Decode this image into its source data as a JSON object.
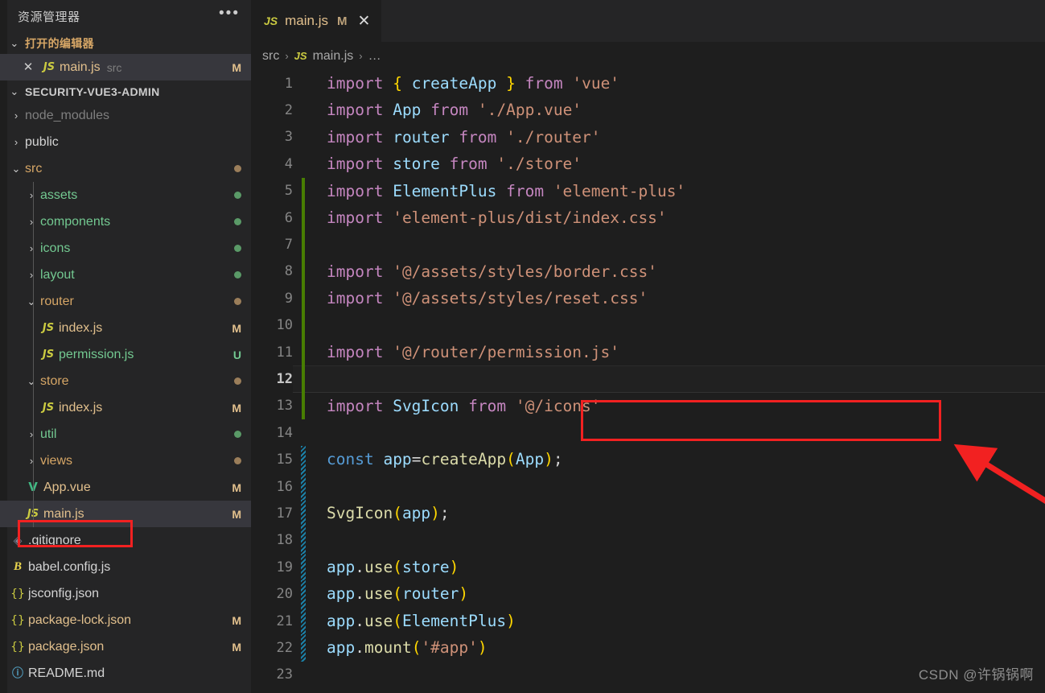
{
  "sidebar": {
    "title": "资源管理器",
    "more_icon": "•••",
    "open_editors": {
      "label": "打开的编辑器",
      "expanded_icon": "⌄",
      "items": [
        {
          "close_icon": "✕",
          "file_icon": "JS",
          "name": "main.js",
          "path": "src",
          "badge": "M"
        }
      ]
    },
    "project": {
      "label": "SECURITY-VUE3-ADMIN",
      "expanded_icon": "⌄"
    },
    "tree": [
      {
        "name": "node_modules",
        "depth": 1,
        "type": "folder",
        "twisty": "›",
        "color": "c-gray",
        "badge": "",
        "dot": ""
      },
      {
        "name": "public",
        "depth": 1,
        "type": "folder",
        "twisty": "›",
        "color": "c-plain",
        "badge": "",
        "dot": ""
      },
      {
        "name": "src",
        "depth": 1,
        "type": "folder",
        "twisty": "⌄",
        "color": "c-amber",
        "badge": "",
        "dot": "d-amber"
      },
      {
        "name": "assets",
        "depth": 2,
        "type": "folder",
        "twisty": "›",
        "color": "c-green",
        "badge": "",
        "dot": "d-green"
      },
      {
        "name": "components",
        "depth": 2,
        "type": "folder",
        "twisty": "›",
        "color": "c-green",
        "badge": "",
        "dot": "d-green"
      },
      {
        "name": "icons",
        "depth": 2,
        "type": "folder",
        "twisty": "›",
        "color": "c-green",
        "badge": "",
        "dot": "d-green"
      },
      {
        "name": "layout",
        "depth": 2,
        "type": "folder",
        "twisty": "›",
        "color": "c-green",
        "badge": "",
        "dot": "d-green"
      },
      {
        "name": "router",
        "depth": 2,
        "type": "folder",
        "twisty": "⌄",
        "color": "c-amber",
        "badge": "",
        "dot": "d-amber"
      },
      {
        "name": "index.js",
        "depth": 3,
        "type": "file",
        "icon": "js",
        "color": "c-tan",
        "badge": "M",
        "badge_color": "c-tan",
        "dot": ""
      },
      {
        "name": "permission.js",
        "depth": 3,
        "type": "file",
        "icon": "js",
        "color": "c-green",
        "badge": "U",
        "badge_color": "c-green",
        "dot": ""
      },
      {
        "name": "store",
        "depth": 2,
        "type": "folder",
        "twisty": "⌄",
        "color": "c-amber",
        "badge": "",
        "dot": "d-amber"
      },
      {
        "name": "index.js",
        "depth": 3,
        "type": "file",
        "icon": "js",
        "color": "c-tan",
        "badge": "M",
        "badge_color": "c-tan",
        "dot": ""
      },
      {
        "name": "util",
        "depth": 2,
        "type": "folder",
        "twisty": "›",
        "color": "c-green",
        "badge": "",
        "dot": "d-green"
      },
      {
        "name": "views",
        "depth": 2,
        "type": "folder",
        "twisty": "›",
        "color": "c-amber",
        "badge": "",
        "dot": "d-amber"
      },
      {
        "name": "App.vue",
        "depth": 2,
        "type": "file",
        "icon": "vue",
        "color": "c-tan",
        "badge": "M",
        "badge_color": "c-tan",
        "dot": ""
      },
      {
        "name": "main.js",
        "depth": 2,
        "type": "file",
        "icon": "js",
        "color": "c-tan",
        "badge": "M",
        "badge_color": "c-tan",
        "dot": "",
        "selected": true
      },
      {
        "name": ".gitignore",
        "depth": 1,
        "type": "file",
        "icon": "git",
        "color": "c-plain",
        "badge": "",
        "dot": ""
      },
      {
        "name": "babel.config.js",
        "depth": 1,
        "type": "file",
        "icon": "babel",
        "color": "c-plain",
        "badge": "",
        "dot": ""
      },
      {
        "name": "jsconfig.json",
        "depth": 1,
        "type": "file",
        "icon": "json",
        "color": "c-plain",
        "badge": "",
        "dot": ""
      },
      {
        "name": "package-lock.json",
        "depth": 1,
        "type": "file",
        "icon": "json",
        "color": "c-tan",
        "badge": "M",
        "badge_color": "c-tan",
        "dot": ""
      },
      {
        "name": "package.json",
        "depth": 1,
        "type": "file",
        "icon": "json",
        "color": "c-tan",
        "badge": "M",
        "badge_color": "c-tan",
        "dot": ""
      },
      {
        "name": "README.md",
        "depth": 1,
        "type": "file",
        "icon": "md",
        "color": "c-plain",
        "badge": "",
        "dot": ""
      }
    ]
  },
  "editor": {
    "tab": {
      "file_icon": "JS",
      "label": "main.js",
      "modified": "M",
      "close_icon": "✕"
    },
    "breadcrumb": {
      "root": "src",
      "sep": "›",
      "file_icon": "JS",
      "file": "main.js",
      "ellipsis": "…"
    },
    "active_line": 12,
    "lines": [
      {
        "n": 1,
        "gutter": "none",
        "tokens": [
          {
            "t": "import",
            "c": "t-kw"
          },
          {
            "t": " ",
            "c": "t-op"
          },
          {
            "t": "{",
            "c": "t-brc"
          },
          {
            "t": " ",
            "c": "t-op"
          },
          {
            "t": "createApp",
            "c": "t-id"
          },
          {
            "t": " ",
            "c": "t-op"
          },
          {
            "t": "}",
            "c": "t-brc"
          },
          {
            "t": " ",
            "c": "t-op"
          },
          {
            "t": "from",
            "c": "t-kw"
          },
          {
            "t": " ",
            "c": "t-op"
          },
          {
            "t": "'vue'",
            "c": "t-str"
          }
        ]
      },
      {
        "n": 2,
        "gutter": "none",
        "tokens": [
          {
            "t": "import",
            "c": "t-kw"
          },
          {
            "t": " ",
            "c": "t-op"
          },
          {
            "t": "App",
            "c": "t-id"
          },
          {
            "t": " ",
            "c": "t-op"
          },
          {
            "t": "from",
            "c": "t-kw"
          },
          {
            "t": " ",
            "c": "t-op"
          },
          {
            "t": "'./App.vue'",
            "c": "t-str"
          }
        ]
      },
      {
        "n": 3,
        "gutter": "none",
        "tokens": [
          {
            "t": "import",
            "c": "t-kw"
          },
          {
            "t": " ",
            "c": "t-op"
          },
          {
            "t": "router",
            "c": "t-id"
          },
          {
            "t": " ",
            "c": "t-op"
          },
          {
            "t": "from",
            "c": "t-kw"
          },
          {
            "t": " ",
            "c": "t-op"
          },
          {
            "t": "'./router'",
            "c": "t-str"
          }
        ]
      },
      {
        "n": 4,
        "gutter": "none",
        "tokens": [
          {
            "t": "import",
            "c": "t-kw"
          },
          {
            "t": " ",
            "c": "t-op"
          },
          {
            "t": "store",
            "c": "t-id"
          },
          {
            "t": " ",
            "c": "t-op"
          },
          {
            "t": "from",
            "c": "t-kw"
          },
          {
            "t": " ",
            "c": "t-op"
          },
          {
            "t": "'./store'",
            "c": "t-str"
          }
        ]
      },
      {
        "n": 5,
        "gutter": "green",
        "tokens": [
          {
            "t": "import",
            "c": "t-kw"
          },
          {
            "t": " ",
            "c": "t-op"
          },
          {
            "t": "ElementPlus",
            "c": "t-id"
          },
          {
            "t": " ",
            "c": "t-op"
          },
          {
            "t": "from",
            "c": "t-kw"
          },
          {
            "t": " ",
            "c": "t-op"
          },
          {
            "t": "'element-plus'",
            "c": "t-str"
          }
        ]
      },
      {
        "n": 6,
        "gutter": "green",
        "tokens": [
          {
            "t": "import",
            "c": "t-kw"
          },
          {
            "t": " ",
            "c": "t-op"
          },
          {
            "t": "'element-plus/dist/index.css'",
            "c": "t-str"
          }
        ]
      },
      {
        "n": 7,
        "gutter": "green",
        "tokens": []
      },
      {
        "n": 8,
        "gutter": "green",
        "tokens": [
          {
            "t": "import",
            "c": "t-kw"
          },
          {
            "t": " ",
            "c": "t-op"
          },
          {
            "t": "'@/assets/styles/border.css'",
            "c": "t-str"
          }
        ]
      },
      {
        "n": 9,
        "gutter": "green",
        "tokens": [
          {
            "t": "import",
            "c": "t-kw"
          },
          {
            "t": " ",
            "c": "t-op"
          },
          {
            "t": "'@/assets/styles/reset.css'",
            "c": "t-str"
          }
        ]
      },
      {
        "n": 10,
        "gutter": "green",
        "tokens": []
      },
      {
        "n": 11,
        "gutter": "green",
        "tokens": [
          {
            "t": "import",
            "c": "t-kw"
          },
          {
            "t": " ",
            "c": "t-op"
          },
          {
            "t": "'@/router/permission.js'",
            "c": "t-str"
          }
        ]
      },
      {
        "n": 12,
        "gutter": "green",
        "tokens": []
      },
      {
        "n": 13,
        "gutter": "green",
        "tokens": [
          {
            "t": "import",
            "c": "t-kw"
          },
          {
            "t": " ",
            "c": "t-op"
          },
          {
            "t": "SvgIcon",
            "c": "t-id"
          },
          {
            "t": " ",
            "c": "t-op"
          },
          {
            "t": "from",
            "c": "t-kw"
          },
          {
            "t": " ",
            "c": "t-op"
          },
          {
            "t": "'@/icons'",
            "c": "t-str"
          }
        ]
      },
      {
        "n": 14,
        "gutter": "none",
        "tokens": []
      },
      {
        "n": 15,
        "gutter": "hatch",
        "tokens": [
          {
            "t": "const",
            "c": "t-decl"
          },
          {
            "t": " ",
            "c": "t-op"
          },
          {
            "t": "app",
            "c": "t-id"
          },
          {
            "t": "=",
            "c": "t-op"
          },
          {
            "t": "createApp",
            "c": "t-fn"
          },
          {
            "t": "(",
            "c": "t-brc"
          },
          {
            "t": "App",
            "c": "t-id"
          },
          {
            "t": ")",
            "c": "t-brc"
          },
          {
            "t": ";",
            "c": "t-op"
          }
        ]
      },
      {
        "n": 16,
        "gutter": "hatch",
        "tokens": []
      },
      {
        "n": 17,
        "gutter": "hatch",
        "tokens": [
          {
            "t": "SvgIcon",
            "c": "t-fn"
          },
          {
            "t": "(",
            "c": "t-brc"
          },
          {
            "t": "app",
            "c": "t-id"
          },
          {
            "t": ")",
            "c": "t-brc"
          },
          {
            "t": ";",
            "c": "t-op"
          }
        ]
      },
      {
        "n": 18,
        "gutter": "hatch",
        "tokens": []
      },
      {
        "n": 19,
        "gutter": "hatch",
        "tokens": [
          {
            "t": "app",
            "c": "t-id"
          },
          {
            "t": ".",
            "c": "t-op"
          },
          {
            "t": "use",
            "c": "t-fn"
          },
          {
            "t": "(",
            "c": "t-brc"
          },
          {
            "t": "store",
            "c": "t-id"
          },
          {
            "t": ")",
            "c": "t-brc"
          }
        ]
      },
      {
        "n": 20,
        "gutter": "hatch",
        "tokens": [
          {
            "t": "app",
            "c": "t-id"
          },
          {
            "t": ".",
            "c": "t-op"
          },
          {
            "t": "use",
            "c": "t-fn"
          },
          {
            "t": "(",
            "c": "t-brc"
          },
          {
            "t": "router",
            "c": "t-id"
          },
          {
            "t": ")",
            "c": "t-brc"
          }
        ]
      },
      {
        "n": 21,
        "gutter": "hatch",
        "tokens": [
          {
            "t": "app",
            "c": "t-id"
          },
          {
            "t": ".",
            "c": "t-op"
          },
          {
            "t": "use",
            "c": "t-fn"
          },
          {
            "t": "(",
            "c": "t-brc"
          },
          {
            "t": "ElementPlus",
            "c": "t-id"
          },
          {
            "t": ")",
            "c": "t-brc"
          }
        ]
      },
      {
        "n": 22,
        "gutter": "hatch",
        "tokens": [
          {
            "t": "app",
            "c": "t-id"
          },
          {
            "t": ".",
            "c": "t-op"
          },
          {
            "t": "mount",
            "c": "t-fn"
          },
          {
            "t": "(",
            "c": "t-brc"
          },
          {
            "t": "'#app'",
            "c": "t-str"
          },
          {
            "t": ")",
            "c": "t-brc"
          }
        ]
      },
      {
        "n": 23,
        "gutter": "none",
        "tokens": []
      }
    ]
  },
  "annotations": {
    "accent_color": "#f22121",
    "sidebar_box_target": "main.js",
    "code_box_target": "import '@/router/permission.js'",
    "arrow_points_to_line": 12
  },
  "watermark": "CSDN @许锅锅啊"
}
